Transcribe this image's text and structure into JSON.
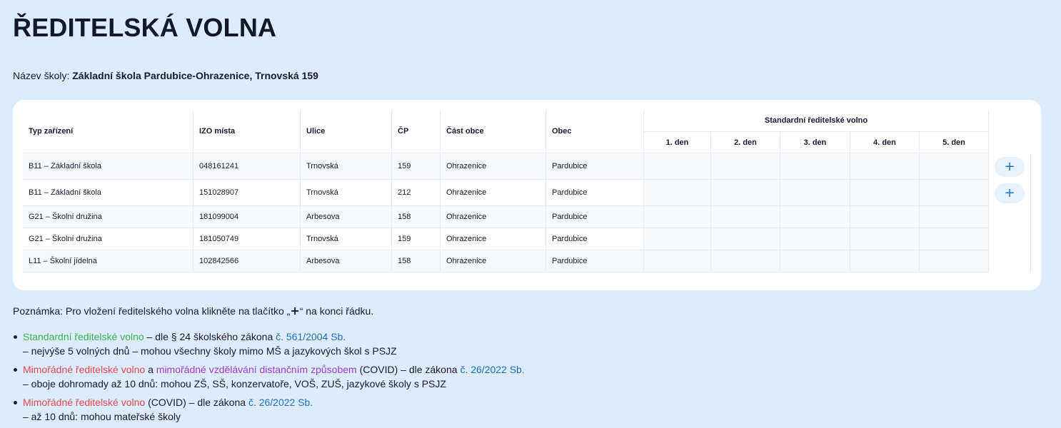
{
  "page": {
    "title": "ŘEDITELSKÁ VOLNA",
    "school_label": "Název školy:",
    "school_name": "Základní škola Pardubice-Ohrazenice, Trnovská 159"
  },
  "table": {
    "headers": {
      "typ": "Typ zařízení",
      "izo": "IZO místa",
      "ulice": "Ulice",
      "cp": "ČP",
      "cast_obce": "Část obce",
      "obec": "Obec",
      "group": "Standardní ředitelské volno",
      "days": [
        "1. den",
        "2. den",
        "3. den",
        "4. den",
        "5. den"
      ]
    },
    "rows": [
      {
        "typ": "B11 – Základní škola",
        "izo": "048161241",
        "ulice": "Trnovská",
        "cp": "159",
        "cast_obce": "Ohrazenice",
        "obec": "Pardubice",
        "add": "+"
      },
      {
        "typ": "B11 – Základní škola",
        "izo": "151028907",
        "ulice": "Trnovská",
        "cp": "212",
        "cast_obce": "Ohrazenice",
        "obec": "Pardubice",
        "add": "+"
      },
      {
        "typ": "G21 – Školní družina",
        "izo": "181099004",
        "ulice": "Arbesova",
        "cp": "158",
        "cast_obce": "Ohrazenice",
        "obec": "Pardubice"
      },
      {
        "typ": "G21 – Školní družina",
        "izo": "181050749",
        "ulice": "Trnovská",
        "cp": "159",
        "cast_obce": "Ohrazenice",
        "obec": "Pardubice"
      },
      {
        "typ": "L11 – Školní jídelna",
        "izo": "102842566",
        "ulice": "Arbesova",
        "cp": "158",
        "cast_obce": "Ohrazenice",
        "obec": "Pardubice"
      }
    ]
  },
  "note": {
    "prefix": "Poznámka: Pro vložení ředitelského volna klikněte na tlačítko „",
    "plus": "+",
    "suffix": "“ na konci řádku."
  },
  "legend": {
    "item1": {
      "green": "Standardní ředitelské volno",
      "text1": " – dle § 24 školského zákona ",
      "link": "č. 561/2004 Sb.",
      "line2": "– nejvýše 5 volných dnů – mohou všechny školy mimo MŠ a jazykových škol s PSJZ"
    },
    "item2": {
      "red": "Mimořádné ředitelské volno",
      "and": " a ",
      "purple": "mimořádné vzdělávání distančním způsobem",
      "text1": " (COVID) – dle zákona ",
      "link": "č. 26/2022 Sb.",
      "line2": "– oboje dohromady až 10 dnů: mohou ZŠ, SŠ, konzervatoře, VOŠ, ZUŠ, jazykové školy s PSJZ"
    },
    "item3": {
      "red": "Mimořádné ředitelské volno",
      "text1": " (COVID) – dle zákona ",
      "link": "č. 26/2022 Sb.",
      "line2": "– až 10 dnů: mohou mateřské školy"
    }
  },
  "colors": {
    "background": "#dcebfd",
    "card": "#ffffff",
    "green": "#3bb54a",
    "red": "#e5484d",
    "purple": "#a23ad6",
    "link": "#1f6fc4"
  }
}
